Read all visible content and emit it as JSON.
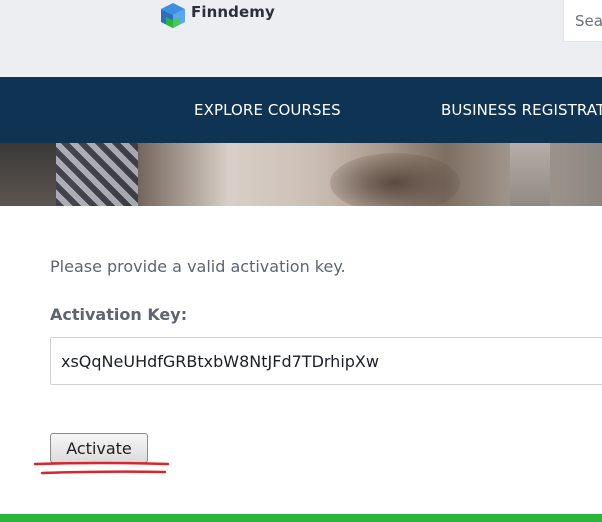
{
  "header": {
    "brand_name": "Finndemy",
    "logo_icon": "cube-logo-icon",
    "search_placeholder": "Search"
  },
  "nav": {
    "items": [
      {
        "label": "EXPLORE COURSES"
      },
      {
        "label": "BUSINESS REGISTRATION"
      }
    ]
  },
  "form": {
    "message": "Please provide a valid activation key.",
    "field_label": "Activation Key:",
    "activation_key_value": "xsQqNeUHdfGRBtxbW8NtJFd7TDrhipXw",
    "submit_label": "Activate"
  },
  "colors": {
    "header_bg": "#edeef2",
    "nav_bg": "#0f3352",
    "accent_green": "#2cb43b",
    "annotation_red": "#d9252c"
  }
}
